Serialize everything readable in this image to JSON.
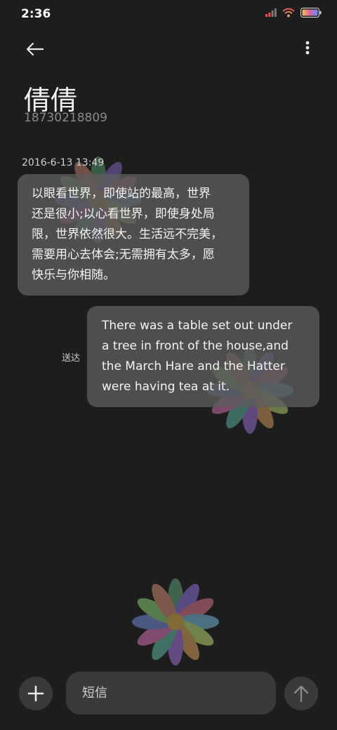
{
  "status_bar": {
    "time": "2:36",
    "icons": [
      "signal-icon",
      "wifi-icon",
      "battery-icon"
    ]
  },
  "header": {
    "back_icon": "back-arrow-icon",
    "more_icon": "more-vertical-icon"
  },
  "contact": {
    "name": "倩倩",
    "number": "18730218809"
  },
  "conversation": {
    "timestamp": "2016-6-13 13:49",
    "received_message": "以眼看世界，即使站的最高，世界\n还是很小;以心看世界，即使身处局\n限，世界依然很大。生活远不完美，\n需要用心去体会;无需拥有太多，愿\n快乐与你相随。",
    "sent_message": "There was a table set out under\na tree in front of the house,and\nthe March Hare and the Hatter\nwere having tea at it.",
    "sent_status": "送达"
  },
  "composer": {
    "placeholder": "短信",
    "add_icon": "plus-icon",
    "send_icon": "send-arrow-up-icon"
  },
  "colors": {
    "background": "#1b1b1b",
    "bubble": "#5c5c5c",
    "secondary_text": "#8a8a8a",
    "battery_gradient": [
      "#f0c050",
      "#e060a0",
      "#6090ff"
    ]
  }
}
